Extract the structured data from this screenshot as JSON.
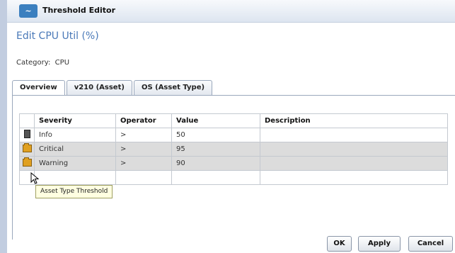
{
  "window": {
    "title": "Threshold Editor",
    "close_glyph": "×",
    "app_icon": "app-logo"
  },
  "heading": "Edit CPU Util (%)",
  "category_line": "Category:  CPU",
  "tabs": [
    {
      "label": "Overview",
      "active": true
    },
    {
      "label": "v210 (Asset)",
      "active": false
    },
    {
      "label": "OS (Asset Type)",
      "active": false
    }
  ],
  "table": {
    "headers": [
      "Severity",
      "Operator",
      "Value",
      "Description"
    ],
    "rows": [
      {
        "icon": "document-icon",
        "severity": "Info",
        "operator": ">",
        "value": "50",
        "description": ""
      },
      {
        "icon": "folder-icon",
        "severity": "Critical",
        "operator": ">",
        "value": "95",
        "description": ""
      },
      {
        "icon": "folder-icon",
        "severity": "Warning",
        "operator": ">",
        "value": "90",
        "description": ""
      },
      {
        "icon": "",
        "severity": "",
        "operator": "",
        "value": "",
        "description": ""
      }
    ]
  },
  "tooltip": "Asset Type Threshold",
  "buttons": {
    "ok": "OK",
    "apply": "Apply",
    "cancel": "Cancel"
  },
  "colors": {
    "heading": "#4a79b8",
    "shaded_row": "#dcdcdc",
    "tooltip_bg": "#ffffe1"
  }
}
